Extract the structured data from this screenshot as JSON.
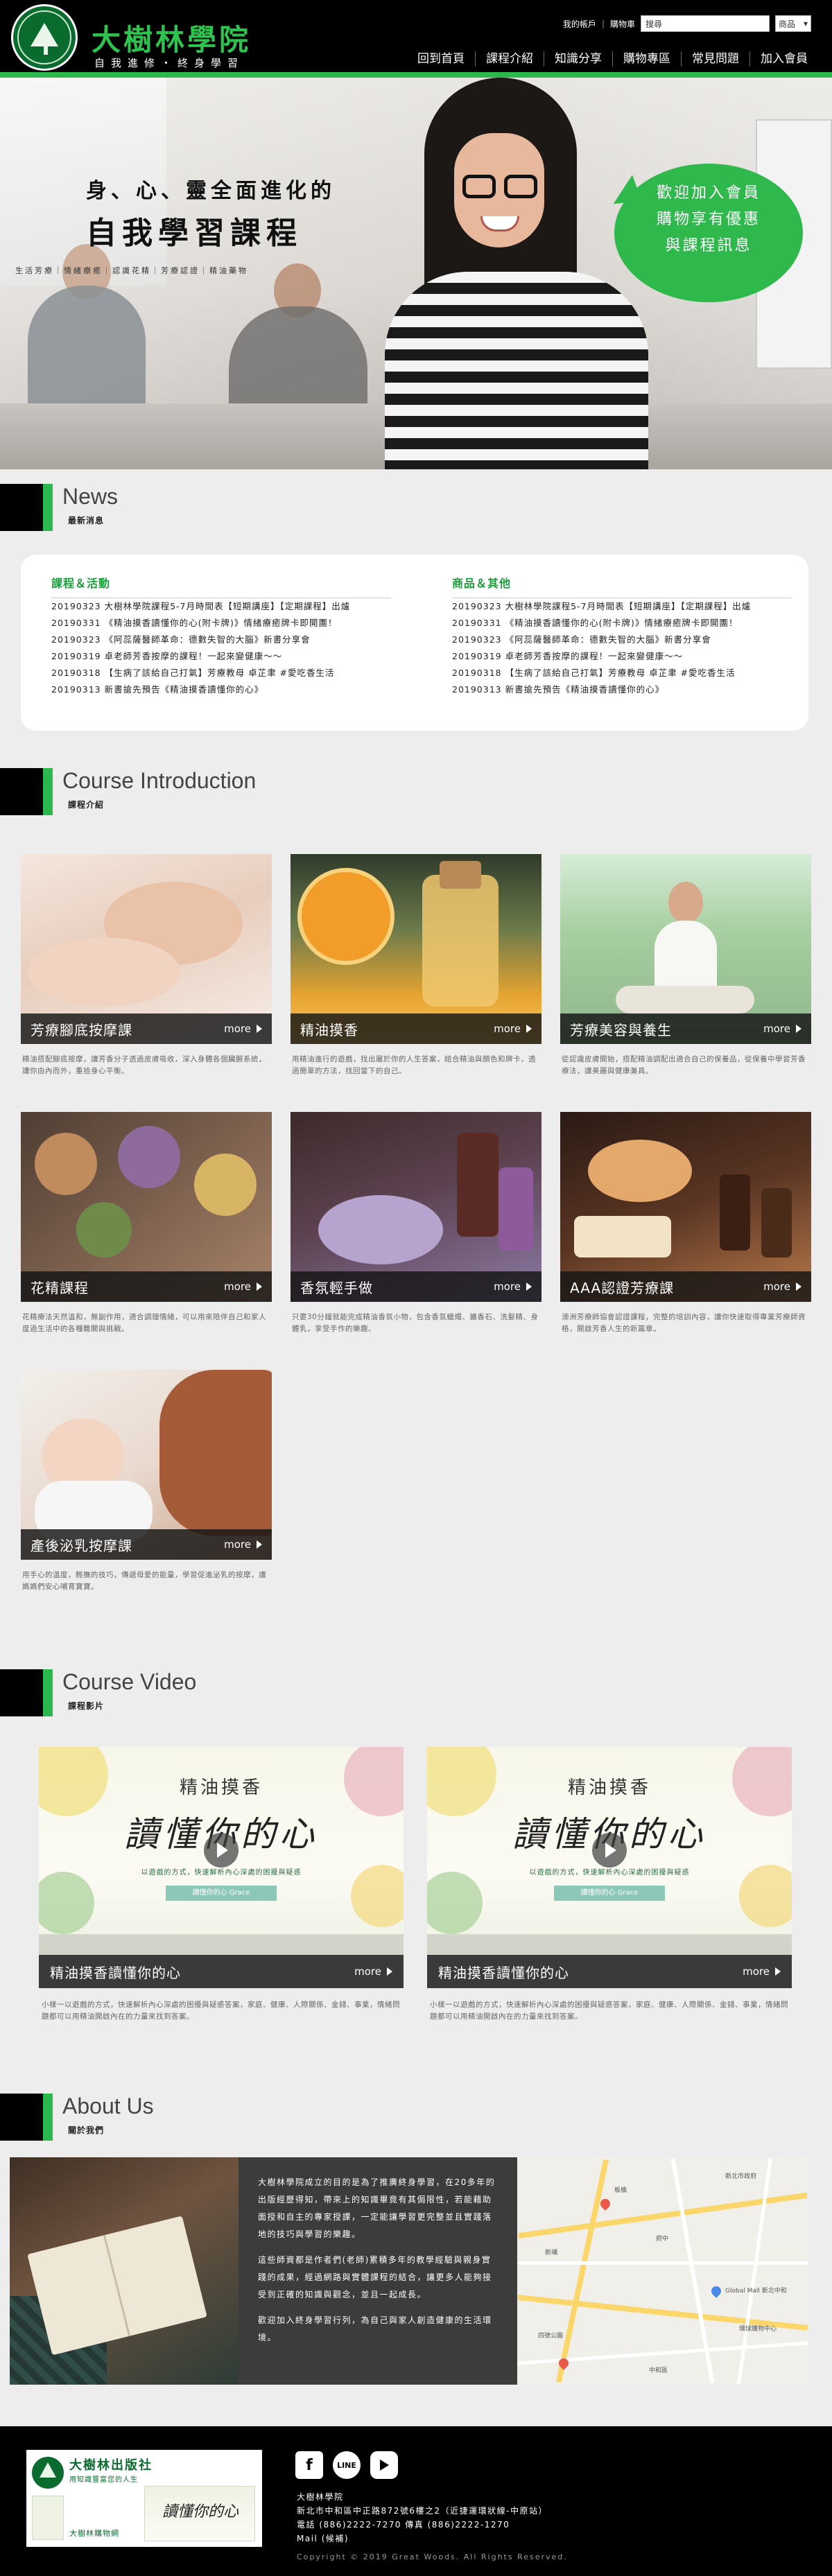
{
  "header": {
    "logo_small_text": "Great Woods Academy",
    "title": "大樹林學院",
    "slogan": "自我進修・終身學習",
    "util": {
      "account": "我的帳戶",
      "cart": "購物車",
      "search_value": "搜尋",
      "select_value": "商品"
    },
    "nav": [
      "回到首頁",
      "課程介紹",
      "知識分享",
      "購物專區",
      "常見問題",
      "加入會員"
    ]
  },
  "hero": {
    "line1": "身、心、靈全面進化的",
    "line2": "自我學習課程",
    "tags": "生活芳療｜情緒療癒｜認識花精｜芳療認證｜精油藥物",
    "bubble": [
      "歡迎加入會員",
      "購物享有優惠",
      "與課程訊息"
    ]
  },
  "news": {
    "en": "News",
    "zh": "最新消息",
    "columns": [
      {
        "title": "課程＆活動",
        "items": [
          "20190323 大樹林學院課程5-7月時間表【短期講座】【定期課程】出爐",
          "20190331 《精油摸香讀懂你的心(附卡牌)》情緒療癒牌卡即開團！",
          "20190323 《阿蕊薩醫師革命：德數失智的大腦》新書分享會",
          "20190319 卓老師芳香按摩的課程！一起來變健康～～",
          "20190318 【生病了該給自己打氣】芳療教母 卓芷聿 #愛吃香生活",
          "20190313 新書搶先預告《精油摸香讀懂你的心》"
        ]
      },
      {
        "title": "商品＆其他",
        "items": [
          "20190323 大樹林學院課程5-7月時間表【短期講座】【定期課程】出爐",
          "20190331 《精油摸香讀懂你的心(附卡牌)》情緒療癒牌卡即開團！",
          "20190323 《阿蕊薩醫師革命：德數失智的大腦》新書分享會",
          "20190319 卓老師芳香按摩的課程！一起來變健康～～",
          "20190318 【生病了該給自己打氣】芳療教母 卓芷聿 #愛吃香生活",
          "20190313 新書搶先預告《精油摸香讀懂你的心》"
        ]
      }
    ]
  },
  "courses": {
    "en": "Course Introduction",
    "zh": "課程介紹",
    "more": "more",
    "items": [
      {
        "title": "芳療腳底按摩課",
        "desc": "精油搭配腳底按摩，讓芳香分子透過皮膚吸收，深入身體各個臟腑系統，讓你由內而外，重拾身心平衡。"
      },
      {
        "title": "精油摸香",
        "desc": "用精油進行的遊戲，找出屬於你的人生答案，結合精油與顏色和牌卡，透過簡單的方法，找回當下的自己。"
      },
      {
        "title": "芳療美容與養生",
        "desc": "從認識皮膚開始，搭配精油調配出適合自己的保養品，從保養中學習芳香療法，讓美麗與健康兼具。"
      },
      {
        "title": "花精課程",
        "desc": "花精療法天然溫和，無副作用，適合調理情緒，可以用來陪伴自己和家人度過生活中的各種難關與挑戰。"
      },
      {
        "title": "香氛輕手做",
        "desc": "只要30分鐘就能完成精油香氛小物，包含香氛蠟燭、擴香石、洗髮精、身體乳，享受手作的樂趣。"
      },
      {
        "title": "AAA認證芳療課",
        "desc": "澳洲芳療師協會認證課程，完整的培訓內容，讓你快速取得專業芳療師資格，開啟芳香人生的新篇章。"
      },
      {
        "title": "產後泌乳按摩課",
        "desc": "用手心的溫度，輕撫的技巧，傳遞母愛的能量，學習促進泌乳的按摩，讓媽媽們安心哺育寶寶。"
      }
    ]
  },
  "videos": {
    "en": "Course Video",
    "zh": "課程影片",
    "more": "more",
    "items": [
      {
        "title_small": "精油摸香",
        "title_big": "讀懂你的心",
        "sub": "以遊戲的方式，快速解析內心深處的困擾與疑惑",
        "ribbon": "讀懂你的心 Grace",
        "caption": "精油摸香讀懂你的心",
        "desc": "小樣一以遊戲的方式，快速解析內心深處的困擾與疑惑答案，家庭、健康、人際關係、金錢、事業，情緒問題都可以用精油開啟內在的力量來找到答案。"
      },
      {
        "title_small": "精油摸香",
        "title_big": "讀懂你的心",
        "sub": "以遊戲的方式，快速解析內心深處的困擾與疑惑",
        "ribbon": "讀懂你的心 Grace",
        "caption": "精油摸香讀懂你的心",
        "desc": "小樣一以遊戲的方式，快速解析內心深處的困擾與疑惑答案，家庭、健康、人際關係、金錢、事業，情緒問題都可以用精油開啟內在的力量來找到答案。"
      }
    ]
  },
  "about": {
    "en": "About Us",
    "zh": "關於我們",
    "paragraphs": [
      "大樹林學院成立的目的是為了推廣終身學習，在20多年的出版經歷得知，帶來上的知識畢竟有其侷限性，若能藉助面授和自主的專家授課，一定能讓學習更完整並且實踐落地的技巧與學習的樂趣。",
      "這些師資都是作者們(老師)累積多年的教學經驗與親身實踐的成果，經過網路與實體課程的結合，讓更多人能夠接受到正確的知識與觀念，並且一起成長。",
      "歡迎加入終身學習行列，為自己與家人創造健康的生活環境。"
    ],
    "map_labels": [
      "新北市政府",
      "板橋",
      "府中",
      "新埔",
      "Global Mall 新北中和",
      "四號公園",
      "環球購物中心",
      "中和區"
    ]
  },
  "footer": {
    "pub_name": "大樹林出版社",
    "pub_slogan": "用知識豐富您的人生",
    "shop": "大樹林購物網",
    "book_title": "讀懂你的心",
    "social": [
      "f",
      "LINE"
    ],
    "info": [
      "大樹林學院",
      "新北市中和區中正路872號6樓之2（近捷運環狀線-中原站）",
      "電話 (886)2222-7270  傳真 (886)2222-1270",
      "Mail (候補)"
    ],
    "copyright": "Copyright © 2019 Great Woods. All Rights Reserved."
  },
  "colors": {
    "brand_green": "#2bb84c",
    "dark": "#000000",
    "caption_bg": "#3a3a3a"
  }
}
